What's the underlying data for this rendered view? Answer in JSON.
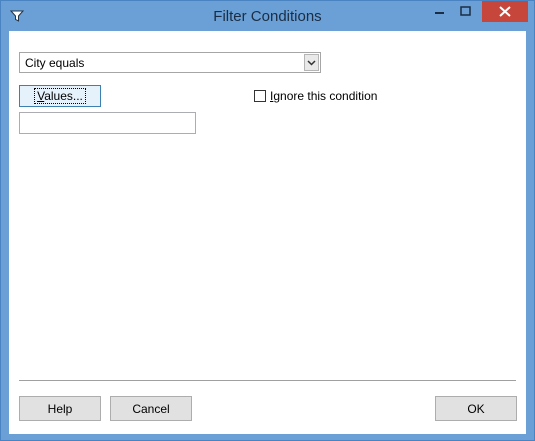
{
  "window": {
    "title": "Filter Conditions",
    "icon": "filter-funnel-icon",
    "close_color": "#c7463b"
  },
  "condition_select": {
    "value": "City equals"
  },
  "values_button": {
    "label_underlined": "V",
    "label_rest": "alues..."
  },
  "values_field": {
    "value": ""
  },
  "ignore_checkbox": {
    "label_underlined": "I",
    "label_rest": "gnore this condition",
    "checked": false
  },
  "footer": {
    "help_label": "Help",
    "cancel_label": "Cancel",
    "ok_label": "OK"
  }
}
